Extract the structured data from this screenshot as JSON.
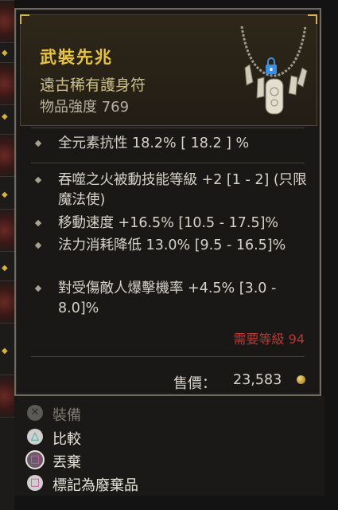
{
  "item": {
    "name": "武裝先兆",
    "type": "遠古稀有護身符",
    "item_power": "物品強度 769",
    "implicit": [
      {
        "text": "全元素抗性 18.2%  [ 18.2 ] %"
      }
    ],
    "affixes": [
      {
        "text": "吞噬之火被動技能等級 +2 [1 - 2] (只限魔法使)"
      },
      {
        "text": "移動速度 +16.5% [10.5 - 17.5]%"
      },
      {
        "text": "法力消耗降低 13.0% [9.5 - 16.5]%"
      },
      {
        "text": "對受傷敵人爆擊機率 +4.5% [3.0 - 8.0]%"
      }
    ],
    "required_level": "需要等級 94",
    "sell_label": "售價：",
    "sell_value": "23,583",
    "locked": true
  },
  "actions": [
    {
      "label": "裝備",
      "icon": "cross-button-icon",
      "enabled": false
    },
    {
      "label": "比較",
      "icon": "triangle-button-icon",
      "enabled": true
    },
    {
      "label": "丟棄",
      "icon": "square-button-icon",
      "enabled": true
    },
    {
      "label": "標記為廢棄品",
      "icon": "square-button-icon",
      "enabled": true
    }
  ],
  "colors": {
    "title": "#e7c445",
    "required_level": "#b63a32",
    "accent_gold": "#d6b048"
  }
}
